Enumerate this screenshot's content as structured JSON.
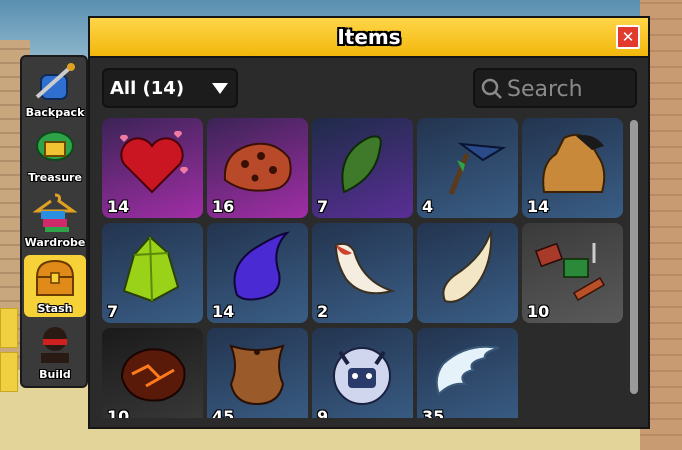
{
  "window": {
    "title": "Items",
    "close_icon": "close-icon"
  },
  "filter": {
    "selected": "All (14)"
  },
  "search": {
    "placeholder": "Search",
    "value": ""
  },
  "sidebar": {
    "items": [
      {
        "label": "Backpack",
        "icon": "backpack-icon",
        "active": false
      },
      {
        "label": "Treasure",
        "icon": "treasure-icon",
        "active": false
      },
      {
        "label": "Wardrobe",
        "icon": "wardrobe-icon",
        "active": false
      },
      {
        "label": "Stash",
        "icon": "stash-chest-icon",
        "active": true
      },
      {
        "label": "Build",
        "icon": "build-avatar-icon",
        "active": false
      }
    ]
  },
  "items": [
    {
      "name": "hearts",
      "qty": "14",
      "rarity": "mythical"
    },
    {
      "name": "meteorite",
      "qty": "16",
      "rarity": "mythical"
    },
    {
      "name": "green-scale",
      "qty": "7",
      "rarity": "legendary"
    },
    {
      "name": "shark-tooth-blade",
      "qty": "4",
      "rarity": "common"
    },
    {
      "name": "sack",
      "qty": "14",
      "rarity": "common"
    },
    {
      "name": "green-crystal",
      "qty": "7",
      "rarity": "common"
    },
    {
      "name": "purple-scale",
      "qty": "14",
      "rarity": "common"
    },
    {
      "name": "fang",
      "qty": "2",
      "rarity": "common"
    },
    {
      "name": "horn",
      "qty": "",
      "rarity": "common"
    },
    {
      "name": "scrap-parts",
      "qty": "10",
      "rarity": "common"
    },
    {
      "name": "magma-ore",
      "qty": "10",
      "rarity": "common"
    },
    {
      "name": "leather",
      "qty": "45",
      "rarity": "common"
    },
    {
      "name": "yeti-fur",
      "qty": "9",
      "rarity": "common"
    },
    {
      "name": "angel-wings",
      "qty": "35",
      "rarity": "common"
    }
  ],
  "colors": {
    "title_bar": "#f5c21a",
    "close": "#e23b2e",
    "active_tab": "#f6d238",
    "rare_slot": "#a12ea6",
    "common_slot": "#3a5e86"
  }
}
